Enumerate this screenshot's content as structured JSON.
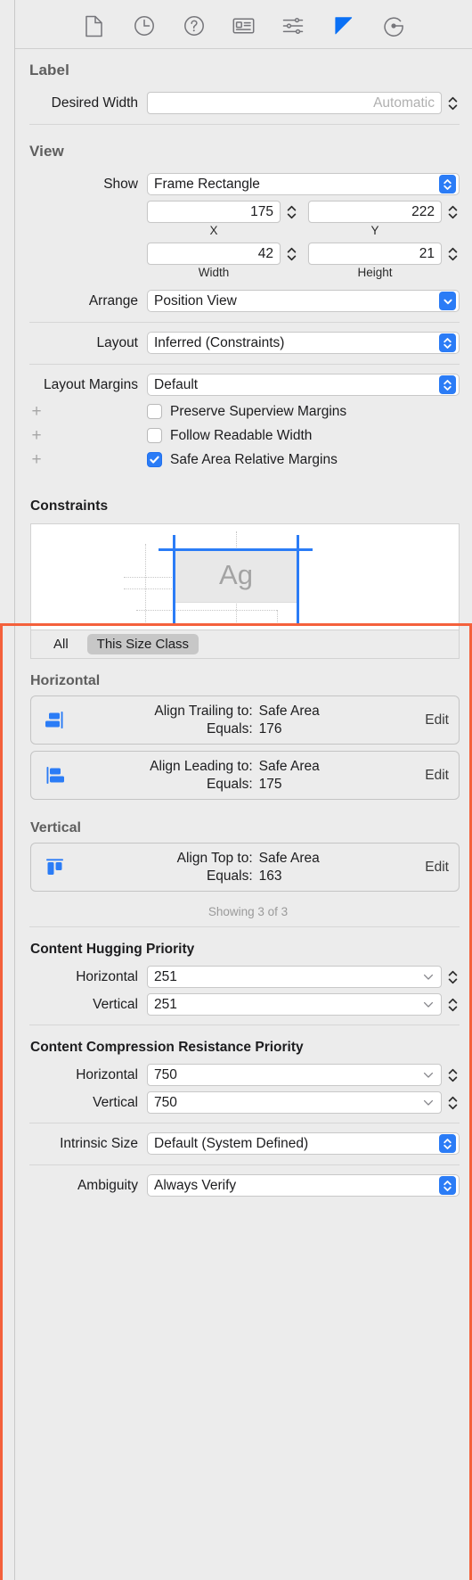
{
  "toolbar": {
    "items": [
      {
        "name": "file-inspector-icon",
        "label": "File inspector",
        "active": false
      },
      {
        "name": "history-inspector-icon",
        "label": "History inspector",
        "active": false
      },
      {
        "name": "quick-help-inspector-icon",
        "label": "Quick Help inspector",
        "active": false
      },
      {
        "name": "identity-inspector-icon",
        "label": "Identity inspector",
        "active": false
      },
      {
        "name": "attributes-inspector-icon",
        "label": "Attributes inspector",
        "active": false
      },
      {
        "name": "size-inspector-icon",
        "label": "Size inspector",
        "active": true
      },
      {
        "name": "connections-inspector-icon",
        "label": "Connections inspector",
        "active": false
      }
    ],
    "accent": "#0a70f5"
  },
  "label_section": {
    "title": "Label",
    "desired_width_label": "Desired Width",
    "desired_width_placeholder": "Automatic",
    "desired_width_value": ""
  },
  "view_section": {
    "title": "View",
    "show_label": "Show",
    "show_value": "Frame Rectangle",
    "x_value": "175",
    "y_value": "222",
    "x_caption": "X",
    "y_caption": "Y",
    "width_value": "42",
    "height_value": "21",
    "width_caption": "Width",
    "height_caption": "Height",
    "arrange_label": "Arrange",
    "arrange_value": "Position View",
    "layout_label": "Layout",
    "layout_value": "Inferred (Constraints)",
    "layout_margins_label": "Layout Margins",
    "layout_margins_value": "Default",
    "checkboxes": [
      {
        "label": "Preserve Superview Margins",
        "checked": false
      },
      {
        "label": "Follow Readable Width",
        "checked": false
      },
      {
        "label": "Safe Area Relative Margins",
        "checked": true
      }
    ],
    "plus_glyph": "+"
  },
  "constraints_section": {
    "title": "Constraints",
    "preview_glyph": "Ag",
    "segments": [
      {
        "label": "All",
        "selected": false
      },
      {
        "label": "This Size Class",
        "selected": true
      }
    ],
    "horizontal_title": "Horizontal",
    "vertical_title": "Vertical",
    "edit_label": "Edit",
    "showing_text": "Showing 3 of 3",
    "horizontal_items": [
      {
        "icon": "align-trailing-icon",
        "relation_key": "Align Trailing to:",
        "relation_value": "Safe Area",
        "equals_key": "Equals:",
        "equals_value": "176"
      },
      {
        "icon": "align-leading-icon",
        "relation_key": "Align Leading to:",
        "relation_value": "Safe Area",
        "equals_key": "Equals:",
        "equals_value": "175"
      }
    ],
    "vertical_items": [
      {
        "icon": "align-top-icon",
        "relation_key": "Align Top to:",
        "relation_value": "Safe Area",
        "equals_key": "Equals:",
        "equals_value": "163"
      }
    ],
    "highlight_color": "#f4613c"
  },
  "hugging": {
    "title": "Content Hugging Priority",
    "horizontal_label": "Horizontal",
    "horizontal_value": "251",
    "vertical_label": "Vertical",
    "vertical_value": "251"
  },
  "compression": {
    "title": "Content Compression Resistance Priority",
    "horizontal_label": "Horizontal",
    "horizontal_value": "750",
    "vertical_label": "Vertical",
    "vertical_value": "750"
  },
  "footer": {
    "intrinsic_size_label": "Intrinsic Size",
    "intrinsic_size_value": "Default (System Defined)",
    "ambiguity_label": "Ambiguity",
    "ambiguity_value": "Always Verify"
  }
}
